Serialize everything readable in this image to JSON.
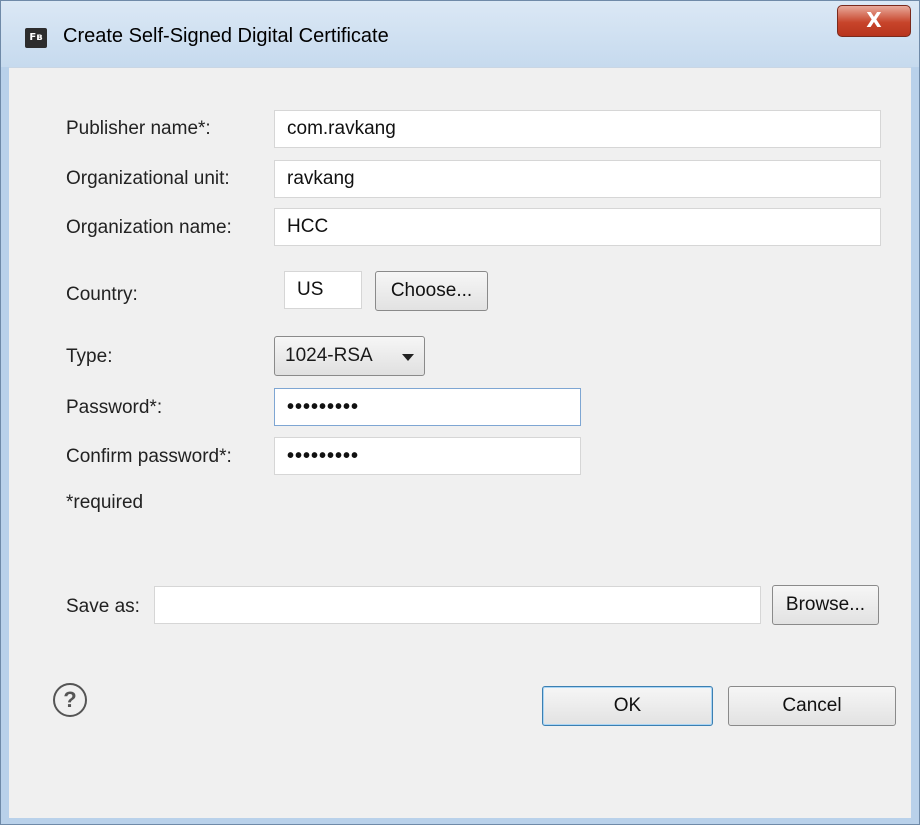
{
  "window": {
    "title": "Create Self-Signed Digital Certificate",
    "app_icon": "Fв",
    "close_label": "X"
  },
  "form": {
    "publisher_label": "Publisher name*:",
    "publisher_value": "com.ravkang",
    "org_unit_label": "Organizational unit:",
    "org_unit_value": "ravkang",
    "org_name_label": "Organization name:",
    "org_name_value": "HCC",
    "country_label": "Country:",
    "country_value": "US",
    "choose_label": "Choose...",
    "type_label": "Type:",
    "type_value": "1024-RSA",
    "password_label": "Password*:",
    "password_value": "•••••••••",
    "confirm_label": "Confirm password*:",
    "confirm_value": "•••••••••",
    "required_note": "*required",
    "save_as_label": "Save as:",
    "save_as_value": "",
    "browse_label": "Browse..."
  },
  "footer": {
    "help_icon": "question-mark-icon",
    "help_glyph": "?",
    "ok_label": "OK",
    "cancel_label": "Cancel"
  },
  "colors": {
    "titlebar": "#c6daee",
    "client_bg": "#f0f0f0",
    "close_button": "#c7442a",
    "focus_border": "#7ea6d3"
  }
}
